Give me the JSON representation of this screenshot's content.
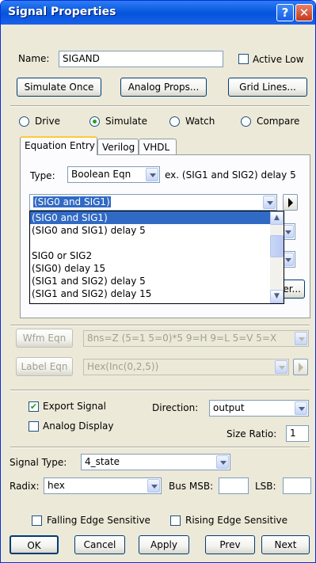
{
  "window": {
    "title": "Signal Properties",
    "help_glyph": "?",
    "close_glyph": "✕"
  },
  "name": {
    "label": "Name:",
    "value": "SIGAND"
  },
  "active_low": {
    "label": "Active Low",
    "checked": false
  },
  "buttons": {
    "simulate_once": "Simulate Once",
    "analog_props": "Analog Props...",
    "grid_lines": "Grid Lines...",
    "ok": "OK",
    "cancel": "Cancel",
    "apply": "Apply",
    "prev": "Prev",
    "next": "Next",
    "partial_hidden": "er..."
  },
  "modes": [
    {
      "label": "Drive",
      "selected": false
    },
    {
      "label": "Simulate",
      "selected": true
    },
    {
      "label": "Watch",
      "selected": false
    },
    {
      "label": "Compare",
      "selected": false
    }
  ],
  "tabs": [
    "Equation Entry",
    "Verilog",
    "VHDL"
  ],
  "type": {
    "label": "Type:",
    "value": "Boolean Eqn",
    "example": "ex. (SIG1 and SIG2) delay 5"
  },
  "equation": {
    "value": "(SIG0 and SIG1)"
  },
  "equation_options": [
    "(SIG0 and SIG1)",
    "(SIG0 and SIG1) delay 5",
    "",
    "SIG0 or SIG2",
    "(SIG0) delay 15",
    "(SIG1 and SIG2) delay 5",
    "(SIG1 and SIG2) delay 15"
  ],
  "wfm_eqn": {
    "label": "Wfm Eqn",
    "value": "8ns=Z (5=1 5=0)*5 9=H 9=L 5=V 5=X"
  },
  "label_eqn": {
    "label": "Label Eqn",
    "value": "Hex(Inc(0,2,5))"
  },
  "export_signal": {
    "label": "Export Signal",
    "checked": true
  },
  "analog_display": {
    "label": "Analog Display",
    "checked": false
  },
  "direction": {
    "label": "Direction:",
    "value": "output"
  },
  "size_ratio": {
    "label": "Size Ratio:",
    "value": "1"
  },
  "signal_type": {
    "label": "Signal Type:",
    "value": "4_state"
  },
  "radix": {
    "label": "Radix:",
    "value": "hex"
  },
  "bus_msb": {
    "label": "Bus MSB:",
    "value": ""
  },
  "lsb": {
    "label": "LSB:",
    "value": ""
  },
  "falling_edge": {
    "label": "Falling Edge Sensitive",
    "checked": false
  },
  "rising_edge": {
    "label": "Rising Edge Sensitive",
    "checked": false
  },
  "check_glyph": "✔"
}
